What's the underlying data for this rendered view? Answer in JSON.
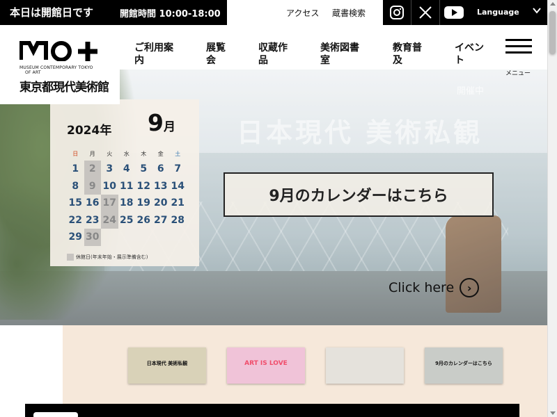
{
  "topbar": {
    "open_today": "本日は開館日です",
    "hours": "開館時間 10:00-18:00",
    "access": "アクセス",
    "collection_search": "蔵書検索",
    "language": "Language",
    "social_icons": [
      "instagram-icon",
      "x-icon",
      "youtube-icon"
    ]
  },
  "logo": {
    "mark": "M0+",
    "sub_line1": "MUSEUM CONTEMPORARY TOKYO",
    "sub_line2": "OF ART",
    "jp": "東京都現代美術館"
  },
  "nav": {
    "items": [
      {
        "line1": "ご利用案",
        "line2": "内"
      },
      {
        "line1": "展覧",
        "line2": "会"
      },
      {
        "line1": "収蔵作",
        "line2": "品"
      },
      {
        "line1": "美術図書",
        "line2": "室"
      },
      {
        "line1": "教育普",
        "line2": "及"
      },
      {
        "line1": "イベン",
        "line2": "ト"
      }
    ],
    "menu_label": "メニュー"
  },
  "hero": {
    "ghost_title": "日本現代 美術私観",
    "ghost_open": "開催中"
  },
  "calendar": {
    "year": "2024年",
    "month_num": "9",
    "month_suffix": "月",
    "weekdays": [
      "日",
      "月",
      "火",
      "水",
      "木",
      "金",
      "土"
    ],
    "weeks": [
      [
        {
          "d": "1"
        },
        {
          "d": "2",
          "closed": true
        },
        {
          "d": "3"
        },
        {
          "d": "4"
        },
        {
          "d": "5"
        },
        {
          "d": "6"
        },
        {
          "d": "7"
        }
      ],
      [
        {
          "d": "8"
        },
        {
          "d": "9",
          "closed": true
        },
        {
          "d": "10"
        },
        {
          "d": "11"
        },
        {
          "d": "12"
        },
        {
          "d": "13"
        },
        {
          "d": "14"
        }
      ],
      [
        {
          "d": "15"
        },
        {
          "d": "16"
        },
        {
          "d": "17",
          "closed": true
        },
        {
          "d": "18"
        },
        {
          "d": "19"
        },
        {
          "d": "20"
        },
        {
          "d": "21"
        }
      ],
      [
        {
          "d": "22"
        },
        {
          "d": "23"
        },
        {
          "d": "24",
          "closed": true
        },
        {
          "d": "25"
        },
        {
          "d": "26"
        },
        {
          "d": "27"
        },
        {
          "d": "28"
        }
      ],
      [
        {
          "d": "29"
        },
        {
          "d": "30",
          "closed": true
        }
      ]
    ],
    "legend": "休館日(年末年始・展示準備含む)"
  },
  "cta": {
    "calendar_link": "9月のカレンダーはこちら",
    "click_here": "Click here",
    "arrow": "›"
  },
  "thumbnails": [
    {
      "caption": "日本現代 美術私観",
      "color": "#d9d2b8"
    },
    {
      "caption": "ART IS LOVE",
      "color": "#f0c3d8"
    },
    {
      "caption": "",
      "color": "#e5e2dc"
    },
    {
      "caption": "9月のカレンダーはこちら",
      "color": "#c9ccc8"
    }
  ],
  "colors": {
    "accent_blue": "#2a5078",
    "closed_gray": "#c7c4c0",
    "sunday_red": "#d0471f",
    "panel_beige": "#f6e8da"
  }
}
